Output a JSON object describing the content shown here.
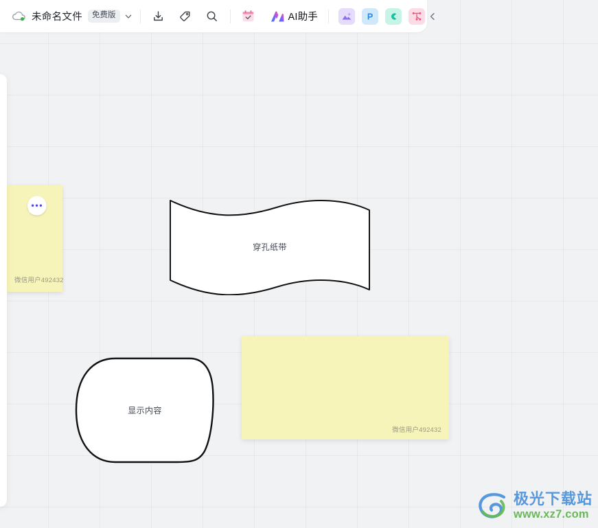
{
  "app": {
    "logo_icon": "cloud-sync-icon"
  },
  "toolbar": {
    "doc_title": "未命名文件",
    "plan_badge": "免费版",
    "title_caret_icon": "chevron-down-icon",
    "save_icon": "download-save-icon",
    "tag_icon": "tag-icon",
    "search_icon": "search-icon",
    "calendar_icon": "calendar-check-icon",
    "ai_icon": "ai-sparkle-icon",
    "ai_label": "AI助手",
    "apps": [
      {
        "name": "image-app",
        "icon": "image-picture-icon",
        "color": "#e5dcfb"
      },
      {
        "name": "ppt-app",
        "icon": "letter-p-icon",
        "color": "#cfe9fb"
      },
      {
        "name": "canva-app",
        "icon": "letter-c-icon",
        "color": "#c8f4e7"
      },
      {
        "name": "mindmap-app",
        "icon": "mind-map-icon",
        "color": "#fbdbe6"
      }
    ],
    "collapse_icon": "chevron-left-icon"
  },
  "canvas": {
    "grid_size_px": 75,
    "background_color": "#f1f2f4",
    "shapes": [
      {
        "id": "note-left",
        "type": "sticky-note",
        "color": "#f7f4ba",
        "text": "",
        "author": "微信用户492432"
      },
      {
        "id": "banner",
        "type": "punched-tape",
        "label": "穿孔纸带",
        "fill": "#ffffff",
        "stroke": "#111111"
      },
      {
        "id": "rounded",
        "type": "display",
        "label": "显示内容",
        "fill": "#ffffff",
        "stroke": "#111111"
      },
      {
        "id": "note-right",
        "type": "sticky-note",
        "color": "#f7f4ba",
        "text": "",
        "author": "微信用户492432"
      }
    ],
    "comment_bubble_icon": "comment-dots-icon"
  },
  "watermark": {
    "title": "极光下载站",
    "url": "www.xz7.com",
    "logo_icon": "aurora-swirl-logo",
    "title_color": "#4a90d9",
    "url_color": "#5bb648"
  }
}
